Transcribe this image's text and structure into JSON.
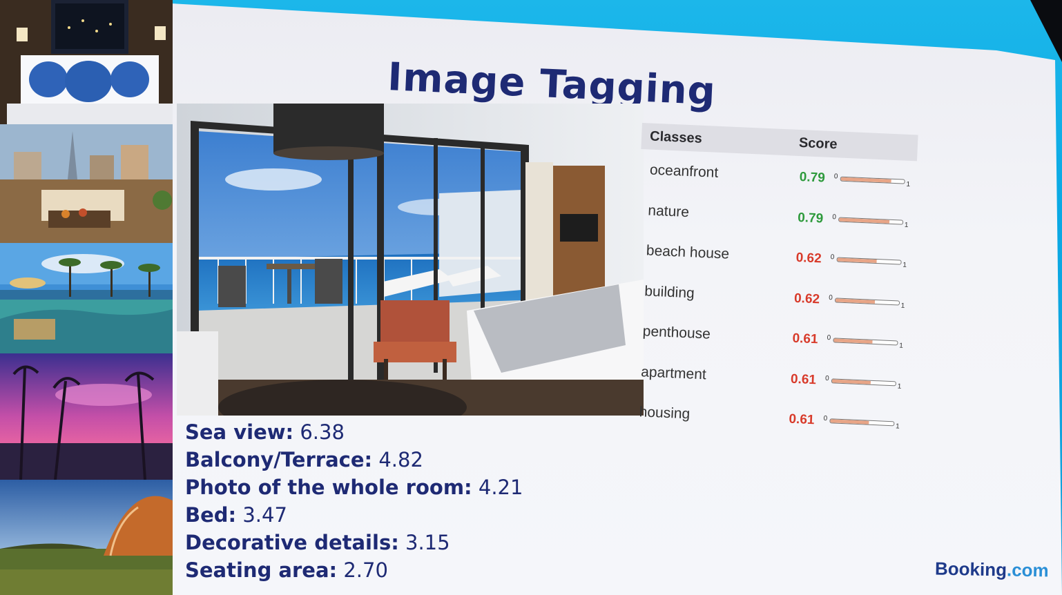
{
  "slide": {
    "title": "Image Tagging"
  },
  "tag_table": {
    "headers": [
      "Classes",
      "Score"
    ],
    "scale_min": "0",
    "scale_max": "1",
    "rows": [
      {
        "class": "oceanfront",
        "score": "0.79",
        "value": 0.79,
        "color": "#2e9a3c"
      },
      {
        "class": "nature",
        "score": "0.79",
        "value": 0.79,
        "color": "#2e9a3c"
      },
      {
        "class": "beach house",
        "score": "0.62",
        "value": 0.62,
        "color": "#d83a2a"
      },
      {
        "class": "building",
        "score": "0.62",
        "value": 0.62,
        "color": "#d83a2a"
      },
      {
        "class": "penthouse",
        "score": "0.61",
        "value": 0.61,
        "color": "#d83a2a"
      },
      {
        "class": "apartment",
        "score": "0.61",
        "value": 0.61,
        "color": "#d83a2a"
      },
      {
        "class": "housing",
        "score": "0.61",
        "value": 0.61,
        "color": "#d83a2a"
      }
    ]
  },
  "scene_scores": [
    {
      "label": "Sea view:",
      "value": "6.38"
    },
    {
      "label": "Balcony/Terrace:",
      "value": "4.82"
    },
    {
      "label": "Photo of the whole room:",
      "value": "4.21"
    },
    {
      "label": "Bed:",
      "value": "3.47"
    },
    {
      "label": "Decorative details:",
      "value": "3.15"
    },
    {
      "label": "Seating area:",
      "value": "2.70"
    }
  ],
  "branding": {
    "name": "Booking",
    "suffix": ".com"
  },
  "thumbnails": [
    "hotel-bedroom",
    "rooftop-terrace",
    "infinity-pool",
    "palm-sunset",
    "barn-field"
  ],
  "colors": {
    "title": "#1e2a74",
    "frame": "#16a9e2",
    "score_high": "#2e9a3c",
    "score_mid": "#d83a2a",
    "bar_fill": "#e8a587"
  }
}
